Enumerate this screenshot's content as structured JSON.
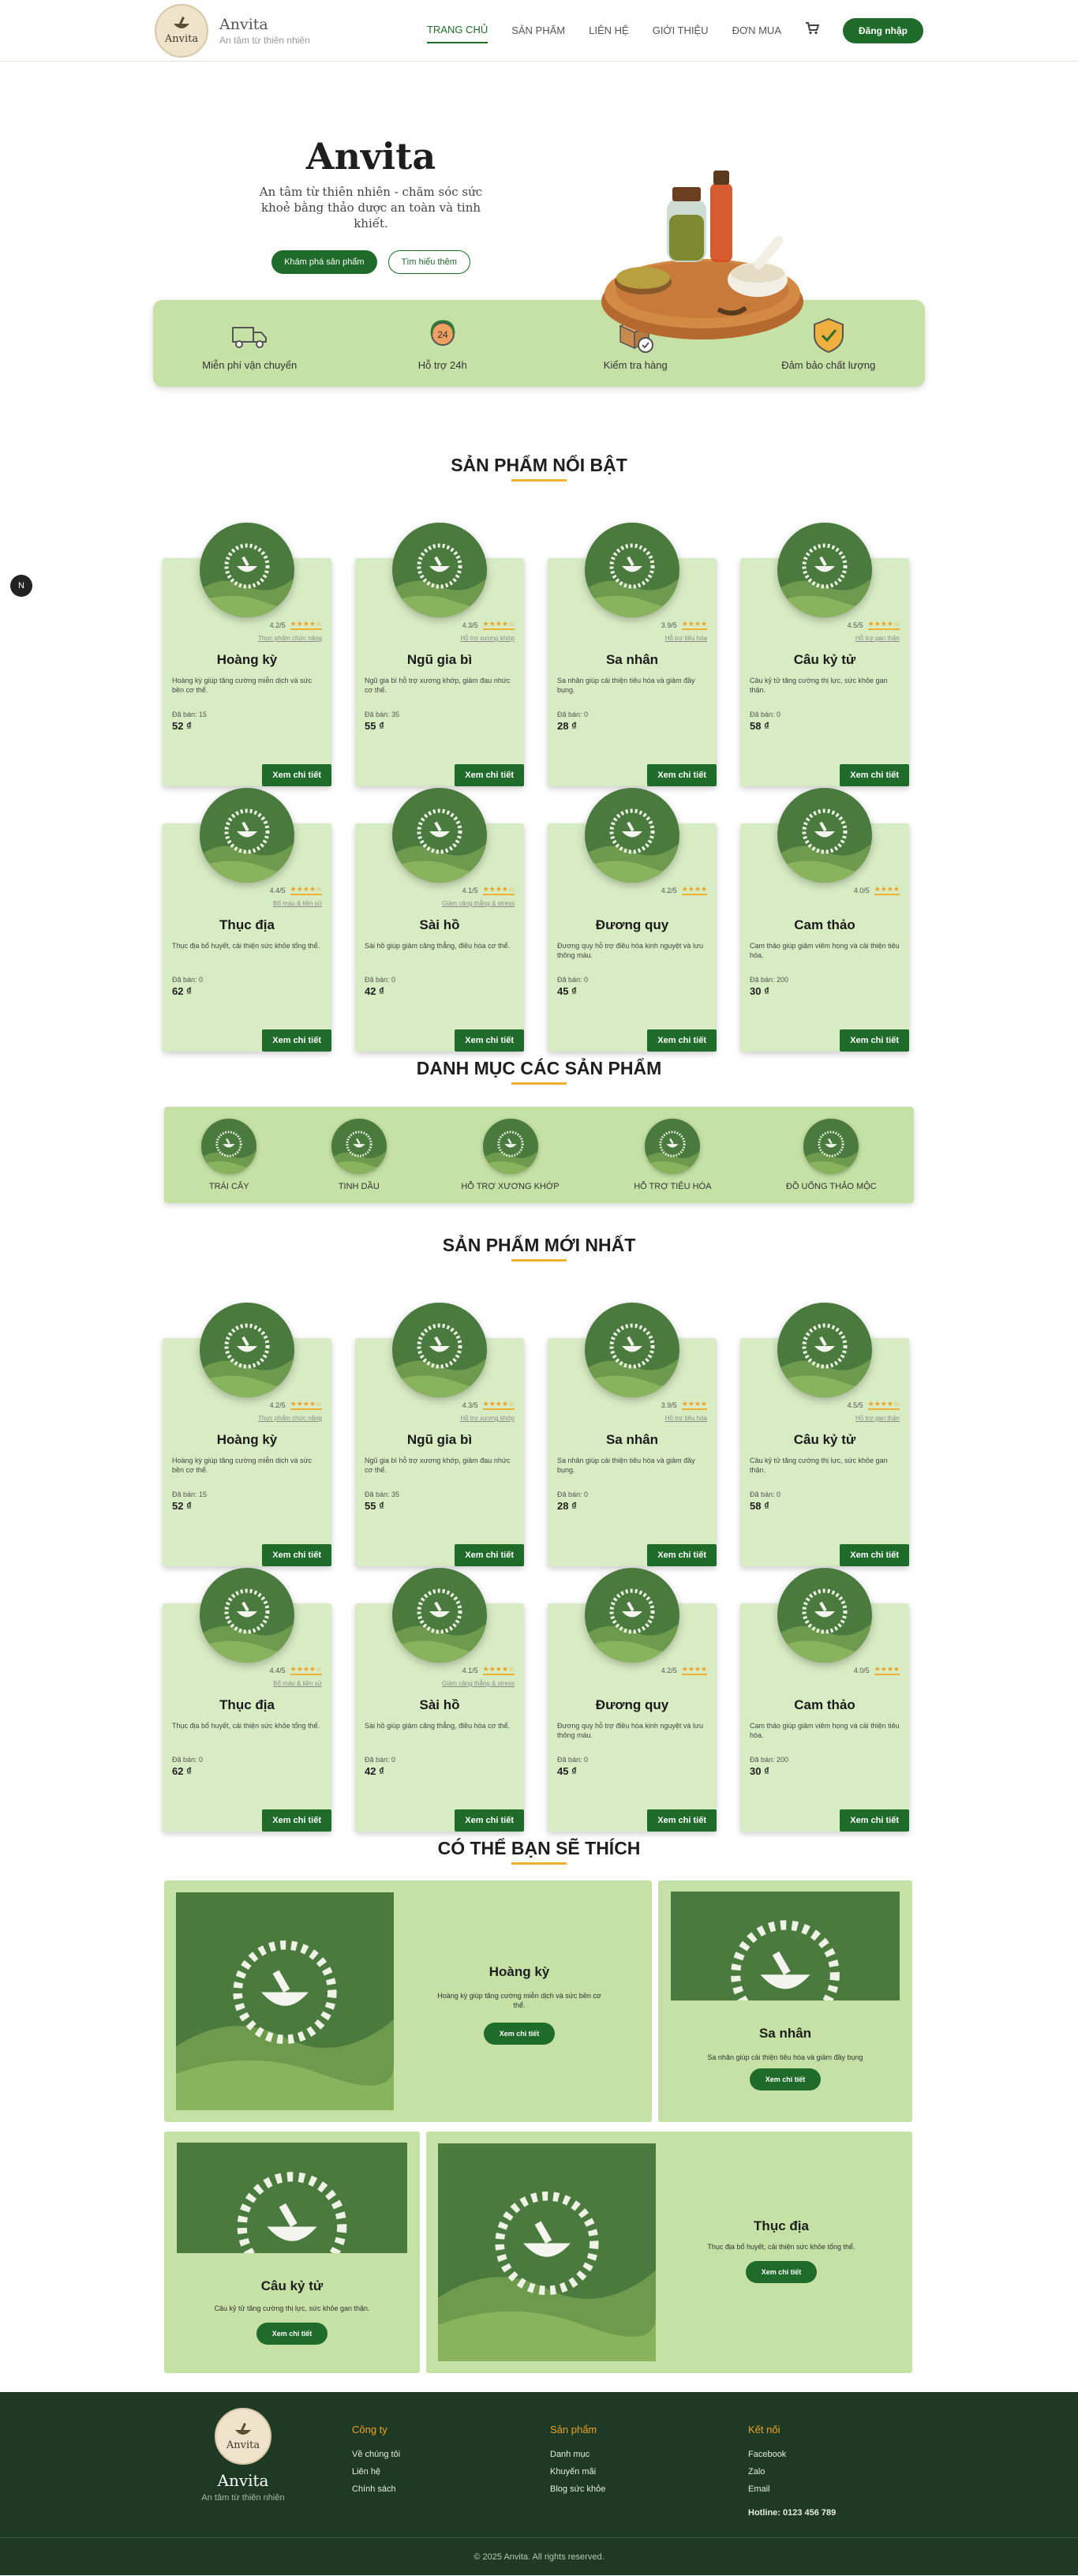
{
  "brand": {
    "name": "Anvita",
    "tagline": "An tâm từ thiên nhiên",
    "logo_text": "Anvita"
  },
  "nav": {
    "items": [
      "TRANG CHỦ",
      "SẢN PHẨM",
      "LIÊN HỆ",
      "GIỚI THIỆU",
      "ĐƠN MUA"
    ],
    "active_index": 0,
    "login": "Đăng nhập",
    "cart_icon": "cart-icon"
  },
  "hero": {
    "title": "Anvita",
    "subtitle": "An tâm từ thiên nhiên - chăm sóc sức khoẻ bằng thảo dược an toàn và tinh khiết.",
    "btn_explore": "Khám phá sản phẩm",
    "btn_learn": "Tìm hiểu thêm"
  },
  "features": [
    {
      "label": "Miễn phí vận chuyển",
      "icon": "truck-icon"
    },
    {
      "label": "Hỗ trợ 24h",
      "icon": "support-24h-icon"
    },
    {
      "label": "Kiểm tra hàng",
      "icon": "box-check-icon"
    },
    {
      "label": "Đảm bảo chất lượng",
      "icon": "shield-check-icon"
    }
  ],
  "sections": {
    "featured": "SẢN PHẨM NỔI BẬT",
    "categories": "DANH MỤC CÁC SẢN PHẨM",
    "newest": "SẢN PHẨM MỚI NHẤT",
    "like": "CÓ THỂ BẠN SẼ THÍCH"
  },
  "products": [
    {
      "name": "Hoàng kỳ",
      "rating": "4.2/5",
      "stars": "★★★★☆",
      "tag": "Thực phẩm chức năng",
      "desc": "Hoàng kỳ giúp tăng cường miễn dịch và sức bền cơ thể.",
      "sold": "Đã bán: 15",
      "price": "52 ₫"
    },
    {
      "name": "Ngũ gia bì",
      "rating": "4.3/5",
      "stars": "★★★★☆",
      "tag": "Hỗ trợ xương khớp",
      "desc": "Ngũ gia bì hỗ trợ xương khớp, giảm đau nhức cơ thể.",
      "sold": "Đã bán: 35",
      "price": "55 ₫"
    },
    {
      "name": "Sa nhân",
      "rating": "3.9/5",
      "stars": "★★★★",
      "tag": "Hỗ trợ tiêu hóa",
      "desc": "Sa nhân giúp cải thiện tiêu hóa và giảm đầy bụng.",
      "sold": "Đã bán: 0",
      "price": "28 ₫"
    },
    {
      "name": "Câu kỷ tử",
      "rating": "4.5/5",
      "stars": "★★★★☆",
      "tag": "Hỗ trợ gan thận",
      "desc": "Câu kỷ tử tăng cường thị lực, sức khỏe gan thận.",
      "sold": "Đã bán: 0",
      "price": "58 ₫"
    },
    {
      "name": "Thục địa",
      "rating": "4.4/5",
      "stars": "★★★★☆",
      "tag": "Bổ máu & tiền sử",
      "desc": "Thục địa bổ huyết, cải thiện sức khỏe tổng thể.",
      "sold": "Đã bán: 0",
      "price": "62 ₫"
    },
    {
      "name": "Sài hồ",
      "rating": "4.1/5",
      "stars": "★★★★☆",
      "tag": "Giảm căng thẳng & stress",
      "desc": "Sài hồ giúp giảm căng thẳng, điều hòa cơ thể.",
      "sold": "Đã bán: 0",
      "price": "42 ₫"
    },
    {
      "name": "Đương quy",
      "rating": "4.2/5",
      "stars": "★★★★",
      "tag": "",
      "desc": "Đương quy hỗ trợ điều hòa kinh nguyệt và lưu thông máu.",
      "sold": "Đã bán: 0",
      "price": "45 ₫"
    },
    {
      "name": "Cam thảo",
      "rating": "4.0/5",
      "stars": "★★★★",
      "tag": "",
      "desc": "Cam thảo giúp giảm viêm họng và cải thiện tiêu hóa.",
      "sold": "Đã bán: 200",
      "price": "30 ₫"
    }
  ],
  "detail_label": "Xem chi tiết",
  "categories": [
    "TRÁI CÂY",
    "TINH DẦU",
    "HỖ TRỢ XƯƠNG KHỚP",
    "HỖ TRỢ TIÊU HÓA",
    "ĐỒ UỐNG THẢO MỘC"
  ],
  "like": [
    {
      "name": "Hoàng kỳ",
      "desc": "Hoàng kỳ giúp tăng cường miễn dịch và sức bền cơ thể."
    },
    {
      "name": "Sa nhân",
      "desc": "Sa nhân giúp cải thiện tiêu hóa và giảm đầy bụng"
    },
    {
      "name": "Câu kỷ tử",
      "desc": "Câu kỷ tử tăng cường thị lực, sức khỏe gan thận."
    },
    {
      "name": "Thục địa",
      "desc": "Thục địa bổ huyết, cải thiện sức khỏe tổng thể."
    }
  ],
  "footer": {
    "brand": "Anvita",
    "tagline": "An tâm từ thiên nhiên",
    "cols": [
      {
        "title": "Công ty",
        "links": [
          "Về chúng tôi",
          "Liên hệ",
          "Chính sách"
        ]
      },
      {
        "title": "Sản phẩm",
        "links": [
          "Danh mục",
          "Khuyến mãi",
          "Blog sức khỏe"
        ]
      },
      {
        "title": "Kết nối",
        "links": [
          "Facebook",
          "Zalo",
          "Email"
        ]
      }
    ],
    "hotline": "Hotline: 0123 456 789",
    "copyright": "© 2025 Anvita. All rights reserved."
  },
  "float_badge": "N",
  "colors": {
    "primary": "#1f6b2a",
    "card": "#d8ecc4",
    "panel": "#c5e1a5",
    "footer": "#1e3a24",
    "accent": "#f0b030"
  }
}
